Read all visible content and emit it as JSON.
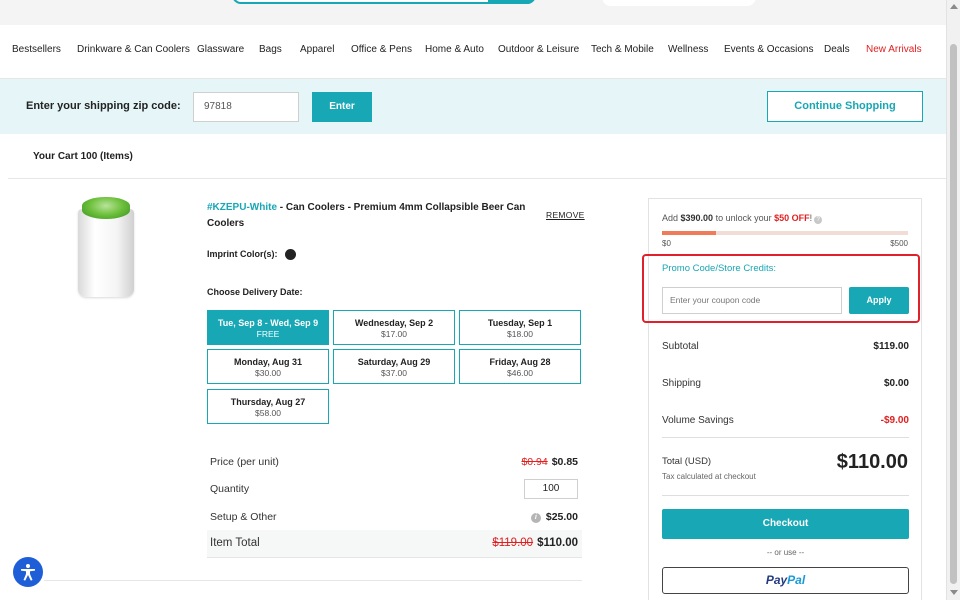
{
  "nav": {
    "items": [
      "Bestsellers",
      "Drinkware & Can Coolers",
      "Glassware",
      "Bags",
      "Apparel",
      "Office & Pens",
      "Home & Auto",
      "Outdoor & Leisure",
      "Tech & Mobile",
      "Wellness",
      "Events & Occasions",
      "Deals",
      "New Arrivals"
    ]
  },
  "zip": {
    "label": "Enter your shipping zip code:",
    "value": "97818",
    "enter_label": "Enter",
    "continue_label": "Continue Shopping"
  },
  "cart": {
    "title": "Your Cart 100 (Items)"
  },
  "product": {
    "sku": "#KZEPU-White",
    "title": " - Can Coolers - Premium 4mm Collapsible Beer Can Coolers",
    "remove_label": "REMOVE",
    "imprint_label": "Imprint Color(s):",
    "imprint_color": "#222222",
    "delivery_label": "Choose Delivery Date:",
    "delivery_options": [
      {
        "date": "Tue, Sep 8 - Wed, Sep 9",
        "price": "FREE",
        "selected": true
      },
      {
        "date": "Wednesday, Sep 2",
        "price": "$17.00"
      },
      {
        "date": "Tuesday, Sep 1",
        "price": "$18.00"
      },
      {
        "date": "Monday, Aug 31",
        "price": "$30.00"
      },
      {
        "date": "Saturday, Aug 29",
        "price": "$37.00"
      },
      {
        "date": "Friday, Aug 28",
        "price": "$46.00"
      },
      {
        "date": "Thursday, Aug 27",
        "price": "$58.00"
      }
    ],
    "price_per_unit_label": "Price (per unit)",
    "price_old": "$0.94",
    "price_new": "$0.85",
    "quantity_label": "Quantity",
    "quantity": "100",
    "setup_label": "Setup & Other",
    "setup_icon": "i",
    "setup_value": "$25.00",
    "item_total_label": "Item Total",
    "item_total_old": "$119.00",
    "item_total_new": "$110.00"
  },
  "summary": {
    "unlock_prefix": "Add ",
    "unlock_amount": "$390.00",
    "unlock_mid": " to unlock your ",
    "unlock_offer": "$50 OFF",
    "unlock_suffix": "!",
    "unlock_help_icon": "?",
    "progress_fraction": 0.22,
    "progress_min": "$0",
    "progress_max": "$500",
    "promo_label": "Promo Code/Store Credits:",
    "coupon_placeholder": "Enter your coupon code",
    "apply_label": "Apply",
    "subtotal_label": "Subtotal",
    "subtotal_value": "$119.00",
    "shipping_label": "Shipping",
    "shipping_value": "$0.00",
    "savings_label": "Volume Savings",
    "savings_value": "-$9.00",
    "total_label": "Total (USD)",
    "total_value": "$110.00",
    "tax_note": "Tax calculated at checkout",
    "checkout_label": "Checkout",
    "or_use": "-- or use --",
    "paypal_pay": "Pay",
    "paypal_pal": "Pal"
  },
  "colors": {
    "accent": "#17a7b5",
    "sale_red": "#e02020",
    "highlight_border": "#e0202a"
  }
}
